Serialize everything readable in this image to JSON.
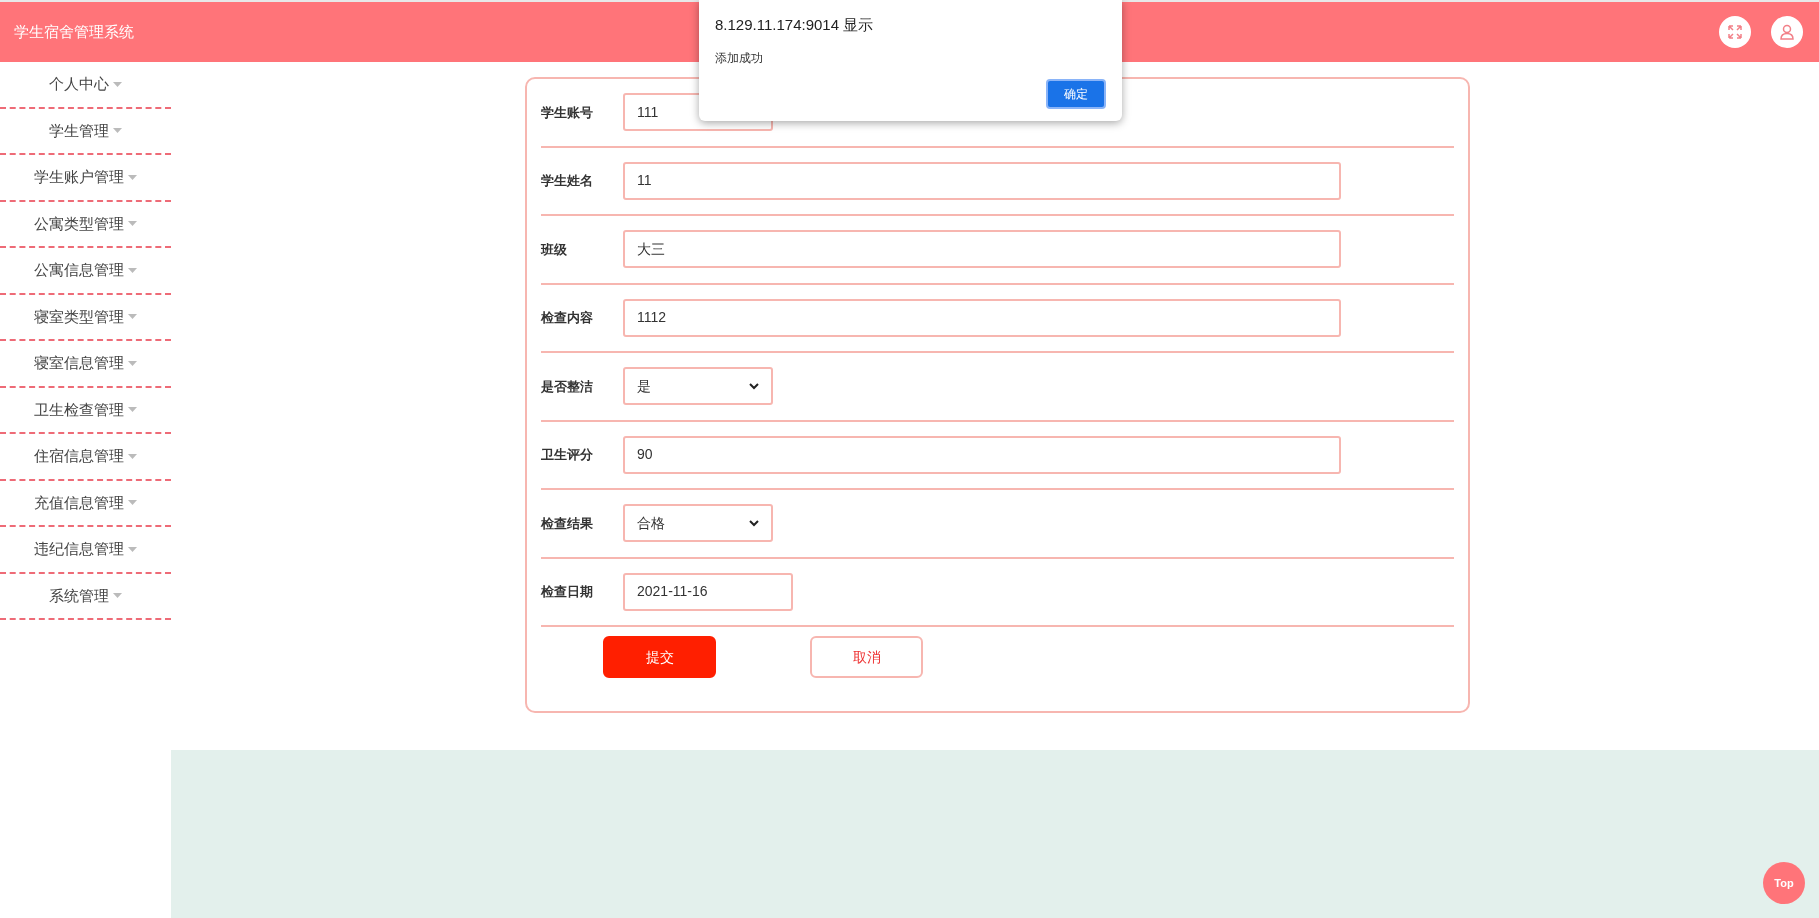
{
  "header": {
    "title": "学生宿舍管理系统"
  },
  "sidebar": {
    "items": [
      {
        "label": "个人中心"
      },
      {
        "label": "学生管理"
      },
      {
        "label": "学生账户管理"
      },
      {
        "label": "公寓类型管理"
      },
      {
        "label": "公寓信息管理"
      },
      {
        "label": "寝室类型管理"
      },
      {
        "label": "寝室信息管理"
      },
      {
        "label": "卫生检查管理"
      },
      {
        "label": "住宿信息管理"
      },
      {
        "label": "充值信息管理"
      },
      {
        "label": "违纪信息管理"
      },
      {
        "label": "系统管理"
      }
    ]
  },
  "form": {
    "fields": [
      {
        "label": "学生账号",
        "kind": "select",
        "value": "111"
      },
      {
        "label": "学生姓名",
        "kind": "text",
        "value": "11"
      },
      {
        "label": "班级",
        "kind": "text",
        "value": "大三"
      },
      {
        "label": "检查内容",
        "kind": "text",
        "value": "1112"
      },
      {
        "label": "是否整洁",
        "kind": "select",
        "value": "是"
      },
      {
        "label": "卫生评分",
        "kind": "text",
        "value": "90"
      },
      {
        "label": "检查结果",
        "kind": "select",
        "value": "合格"
      },
      {
        "label": "检查日期",
        "kind": "date",
        "value": "2021-11-16"
      }
    ],
    "buttons": [
      {
        "label": "提交",
        "kind": "primary"
      },
      {
        "label": "取消",
        "kind": "secondary"
      }
    ]
  },
  "dialog": {
    "title": "8.129.11.174:9014 显示",
    "message": "添加成功",
    "button": "确定"
  },
  "back_to_top": "Top"
}
